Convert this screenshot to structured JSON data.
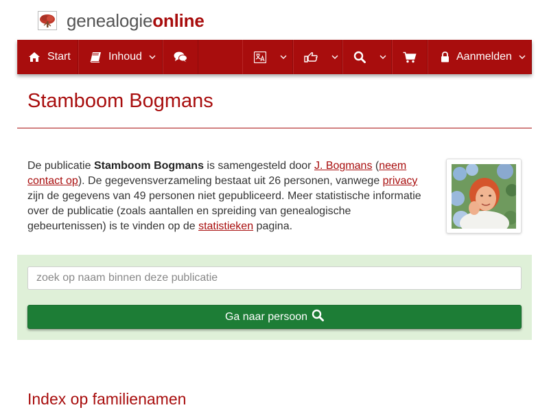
{
  "brand": {
    "part1": "genealogie",
    "part2": "online",
    "logo_icon": "tree-logo-icon"
  },
  "nav": {
    "start": "Start",
    "inhoud": "Inhoud",
    "aanmelden": "Aanmelden",
    "icons": {
      "start": "home-icon",
      "inhoud": "book-icon",
      "comments": "comments-icon",
      "language": "translate-icon",
      "share": "thumbs-up-icon",
      "search": "search-icon",
      "cart": "cart-icon",
      "login": "lock-icon"
    }
  },
  "page": {
    "title": "Stamboom Bogmans"
  },
  "intro": {
    "t1": "De publicatie ",
    "pub_name": "Stamboom Bogmans",
    "t2": " is samengesteld door ",
    "author": "J. Bogmans",
    "t3": " (",
    "contact": "neem contact op",
    "t4": "). De gegevensverzameling bestaat uit 26 personen, vanwege ",
    "privacy": "privacy",
    "t5": " zijn de gegevens van 49 personen niet gepubliceerd. Meer statistische informatie over de publicatie (zoals aantallen en spreiding van genealogische gebeurtenissen) is te vinden op de ",
    "stats": "statistieken",
    "t6": " pagina."
  },
  "search": {
    "placeholder": "zoek op naam binnen deze publicatie",
    "button_label": "Ga naar persoon",
    "button_icon": "search-icon"
  },
  "sections": {
    "index_title": "Index op familienamen"
  },
  "colors": {
    "brand_red": "#a80d0d",
    "panel_green": "#dff0d8",
    "button_green": "#1d7d36"
  }
}
